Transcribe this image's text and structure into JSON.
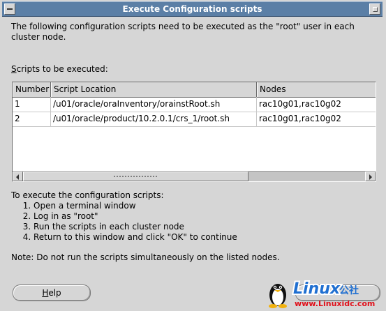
{
  "window": {
    "title": "Execute Configuration scripts"
  },
  "intro_text": "The following configuration scripts need to be executed as the \"root\" user in each cluster node.",
  "scripts_label_accel": "S",
  "scripts_label_rest": "cripts to be executed:",
  "table": {
    "columns": [
      "Number",
      "Script Location",
      "Nodes"
    ],
    "rows": [
      {
        "number": "1",
        "location": "/u01/oracle/oraInventory/orainstRoot.sh",
        "nodes": "rac10g01,rac10g02"
      },
      {
        "number": "2",
        "location": "/u01/oracle/product/10.2.0.1/crs_1/root.sh",
        "nodes": "rac10g01,rac10g02"
      }
    ]
  },
  "instructions": {
    "heading": "To execute the configuration scripts:",
    "steps": [
      "Open a terminal window",
      "Log in as \"root\"",
      "Run the scripts in each cluster node",
      "Return to this window and click \"OK\" to continue"
    ]
  },
  "note": "Note: Do not run the scripts simultaneously on the listed nodes.",
  "buttons": {
    "help_accel": "H",
    "help_rest": "elp"
  },
  "watermark": {
    "logo_text": "Linux",
    "logo_suffix": "公社",
    "url": "www.Linuxidc.com"
  },
  "colors": {
    "title_bar": "#5b7fa6",
    "dialog_bg": "#d6d6d6",
    "table_bg": "#ffffff",
    "watermark_blue": "#1f6fd1",
    "watermark_red": "#e0101a"
  }
}
